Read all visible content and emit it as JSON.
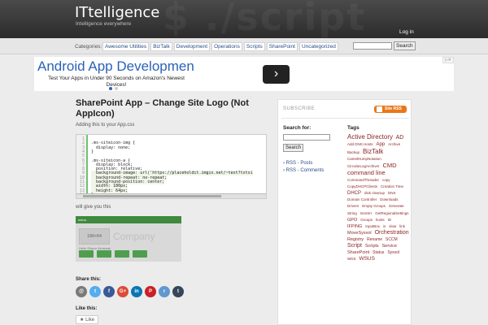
{
  "header": {
    "site_title": "ITtelligence",
    "tagline": "Intelligence everywhere",
    "login": "Log in"
  },
  "categories": {
    "label": "Categories:",
    "items": [
      "Awesome Utilities",
      "BizTalk",
      "Development",
      "Operations",
      "Scripts",
      "SharePoint",
      "Uncategorized"
    ],
    "search_button": "Search"
  },
  "ad": {
    "title": "Android App Developmen",
    "description": "Test Your Apps in Under 90 Seconds on Amazon's Newest Devices!"
  },
  "post": {
    "title": "SharePoint App – Change Site Logo (Not AppIcon)",
    "intro": "Adding this to your App.css",
    "code_lines": [
      "",
      ".ms-siteicon-img {",
      "  display: none;",
      "}",
      "",
      ".ms-siteicon-a {",
      "  display: block;",
      "  position: relative;",
      "  background-image: url('https://placeholdit.imgix.net/~text?txtsi",
      "  background-repeat: no-repeat;",
      "  background-position: center;",
      "  width: 180px;",
      "  height: 64px;",
      "}"
    ],
    "line_numbers": [
      "1",
      "2",
      "3",
      "4",
      "5",
      "6",
      "7",
      "8",
      "9",
      "10",
      "11",
      "12",
      "13",
      "14"
    ],
    "will_give": "will give you this",
    "screenshot": {
      "bar_text": "menu",
      "logo_text": "180×64",
      "company_text": "Company",
      "hello_text": "Hello Shaun Vermaak"
    },
    "share_label": "Share this:",
    "share_buttons": [
      "@",
      "t",
      "f",
      "G+",
      "in",
      "P",
      "r",
      "t"
    ],
    "like_label": "Like this:",
    "like_button": "Like"
  },
  "sidebar": {
    "subscribe": "SUBSCRIBE",
    "rss_badge": "Site RSS Feed",
    "search_label": "Search for:",
    "search_button": "Search",
    "rss_links": [
      "RSS - Posts",
      "RSS - Comments"
    ],
    "tags_heading": "Tags",
    "tags": [
      {
        "t": "Active Directory",
        "s": 8
      },
      {
        "t": "AD",
        "s": 7
      },
      {
        "t": "Add DNS Hosts",
        "s": 4.5
      },
      {
        "t": "App",
        "s": 6
      },
      {
        "t": "Archive",
        "s": 4.5
      },
      {
        "t": "Backup",
        "s": 4.5
      },
      {
        "t": "BizTalk",
        "s": 8
      },
      {
        "t": "CamelHumpNotation",
        "s": 4.5
      },
      {
        "t": "CircularLogArchiver",
        "s": 4.5
      },
      {
        "t": "CMD",
        "s": 7.5
      },
      {
        "t": "command line",
        "s": 7.5
      },
      {
        "t": "CommandThreader",
        "s": 4.5
      },
      {
        "t": "copy",
        "s": 4.5
      },
      {
        "t": "CopyDHCPClients",
        "s": 4.5
      },
      {
        "t": "Creation Time",
        "s": 4.5
      },
      {
        "t": "DHCP",
        "s": 6
      },
      {
        "t": "disk cleanup",
        "s": 4.5
      },
      {
        "t": "DNS",
        "s": 4.5
      },
      {
        "t": "Domain Controller",
        "s": 4.5
      },
      {
        "t": "Downloads",
        "s": 4.5
      },
      {
        "t": "Drivers",
        "s": 4.5
      },
      {
        "t": "Empty Groups",
        "s": 4.5
      },
      {
        "t": "Generate",
        "s": 4.5
      },
      {
        "t": "String",
        "s": 4.5
      },
      {
        "t": "GenSrr",
        "s": 4.5
      },
      {
        "t": "GetRegionalSettings",
        "s": 4.5
      },
      {
        "t": "GPO",
        "s": 5.5
      },
      {
        "t": "Groups",
        "s": 4.5
      },
      {
        "t": "hosts",
        "s": 4.5
      },
      {
        "t": "ID",
        "s": 4.5
      },
      {
        "t": "IFPING",
        "s": 5.5
      },
      {
        "t": "InputBox",
        "s": 4.5
      },
      {
        "t": "is",
        "s": 4.5
      },
      {
        "t": "slow",
        "s": 4.5
      },
      {
        "t": "link",
        "s": 4.5
      },
      {
        "t": "MoveSysvol",
        "s": 5.5
      },
      {
        "t": "Orchestration",
        "s": 7
      },
      {
        "t": "Registry",
        "s": 5.5
      },
      {
        "t": "Rename",
        "s": 5
      },
      {
        "t": "SCCM",
        "s": 5
      },
      {
        "t": "Script",
        "s": 7
      },
      {
        "t": "Scripts",
        "s": 5.5
      },
      {
        "t": "Service",
        "s": 5.5
      },
      {
        "t": "SharePoint",
        "s": 5.5
      },
      {
        "t": "Status",
        "s": 5
      },
      {
        "t": "Sysvol",
        "s": 5
      },
      {
        "t": "WDS",
        "s": 4.5
      },
      {
        "t": "WSUS",
        "s": 6.5
      }
    ]
  },
  "colors": {
    "header_bg": "#2c2c2c",
    "link": "#2a4e8a",
    "tag": "#8b1f1f",
    "rss": "#e8781a",
    "ad_title": "#2a62b8"
  }
}
